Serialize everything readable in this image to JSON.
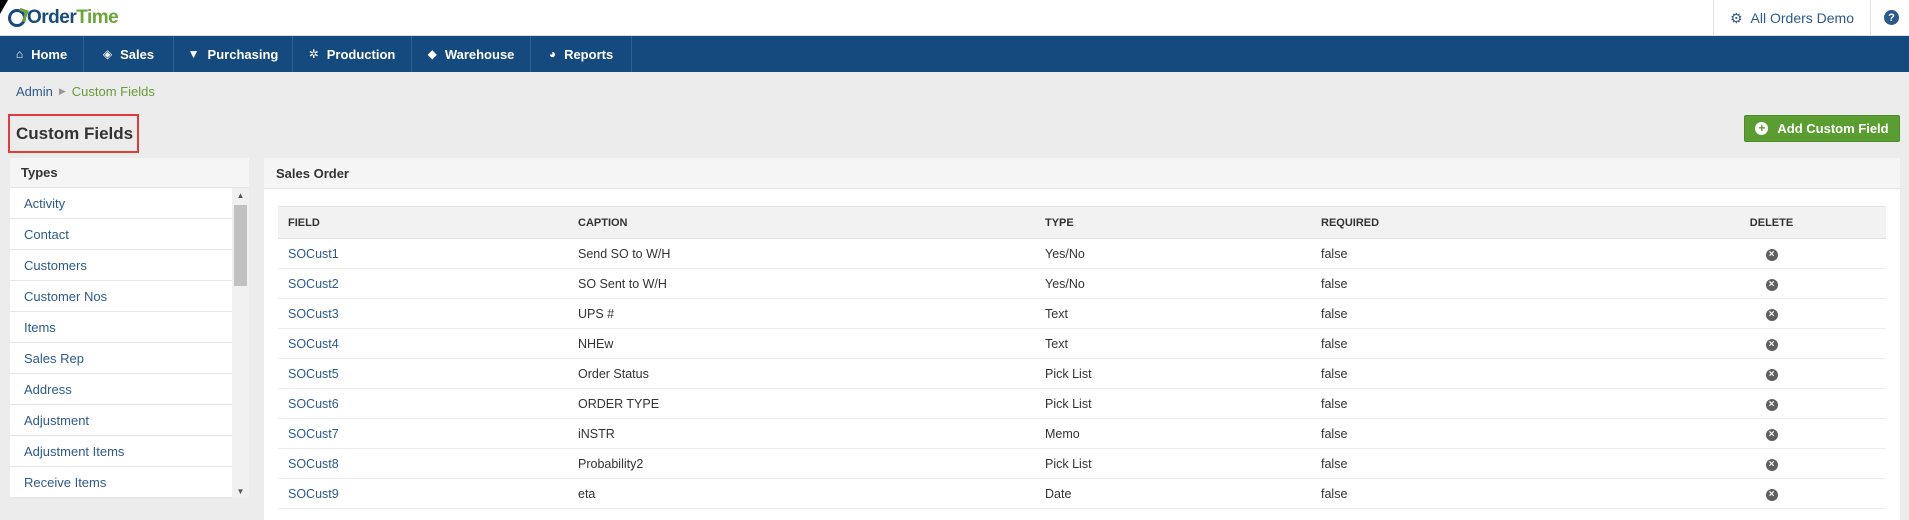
{
  "app": {
    "logo_part1": "Order",
    "logo_part2": "Time",
    "company": "All Orders Demo",
    "help": "?"
  },
  "nav": [
    {
      "label": "Home",
      "icon": "home-icon"
    },
    {
      "label": "Sales",
      "icon": "tag-icon"
    },
    {
      "label": "Purchasing",
      "icon": "cart-icon"
    },
    {
      "label": "Production",
      "icon": "gears-icon"
    },
    {
      "label": "Warehouse",
      "icon": "box-icon"
    },
    {
      "label": "Reports",
      "icon": "pie-chart-icon"
    }
  ],
  "breadcrumb": {
    "admin": "Admin",
    "current": "Custom Fields"
  },
  "page_title": "Custom Fields",
  "add_button_label": "Add Custom Field",
  "types": {
    "header": "Types",
    "items": [
      "Activity",
      "Contact",
      "Customers",
      "Customer Nos",
      "Items",
      "Sales Rep",
      "Address",
      "Adjustment",
      "Adjustment Items",
      "Receive Items"
    ]
  },
  "main": {
    "header": "Sales Order",
    "columns": [
      "FIELD",
      "CAPTION",
      "TYPE",
      "REQUIRED",
      "DELETE"
    ],
    "rows": [
      {
        "field": "SOCust1",
        "caption": "Send SO to W/H",
        "type": "Yes/No",
        "required": "false"
      },
      {
        "field": "SOCust2",
        "caption": "SO Sent to W/H",
        "type": "Yes/No",
        "required": "false"
      },
      {
        "field": "SOCust3",
        "caption": "UPS #",
        "type": "Text",
        "required": "false"
      },
      {
        "field": "SOCust4",
        "caption": "NHEw",
        "type": "Text",
        "required": "false"
      },
      {
        "field": "SOCust5",
        "caption": "Order Status",
        "type": "Pick List",
        "required": "false"
      },
      {
        "field": "SOCust6",
        "caption": "ORDER TYPE",
        "type": "Pick List",
        "required": "false"
      },
      {
        "field": "SOCust7",
        "caption": "iNSTR",
        "type": "Memo",
        "required": "false"
      },
      {
        "field": "SOCust8",
        "caption": "Probability2",
        "type": "Pick List",
        "required": "false"
      },
      {
        "field": "SOCust9",
        "caption": "eta",
        "type": "Date",
        "required": "false"
      }
    ]
  },
  "colors": {
    "nav_bg": "#154a7e",
    "accent_green": "#5a9e31",
    "link_blue": "#2c5a8c",
    "highlight_red": "#e03c3c"
  }
}
